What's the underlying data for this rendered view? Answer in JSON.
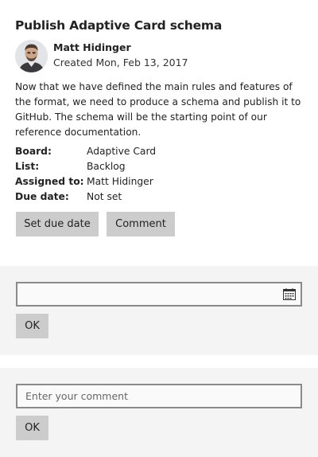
{
  "card": {
    "title": "Publish Adaptive Card schema",
    "author": "Matt Hidinger",
    "created": "Created Mon, Feb 13, 2017",
    "description": "Now that we have defined the main rules and features of the format, we need to produce a schema and publish it to GitHub. The schema will be the starting point of our reference documentation.",
    "facts": [
      {
        "key": "Board:",
        "value": "Adaptive Card"
      },
      {
        "key": "List:",
        "value": "Backlog"
      },
      {
        "key": "Assigned to:",
        "value": "Matt Hidinger"
      },
      {
        "key": "Due date:",
        "value": "Not set"
      }
    ],
    "actions": {
      "set_due_date": "Set due date",
      "comment": "Comment"
    }
  },
  "date_panel": {
    "input_value": "",
    "icon": "calendar-icon",
    "ok_label": "OK"
  },
  "comment_panel": {
    "placeholder": "Enter your comment",
    "ok_label": "OK"
  },
  "colors": {
    "panel_bg": "#f4f4f4",
    "button_bg": "#cccccc",
    "input_border": "#8a8a8a"
  }
}
